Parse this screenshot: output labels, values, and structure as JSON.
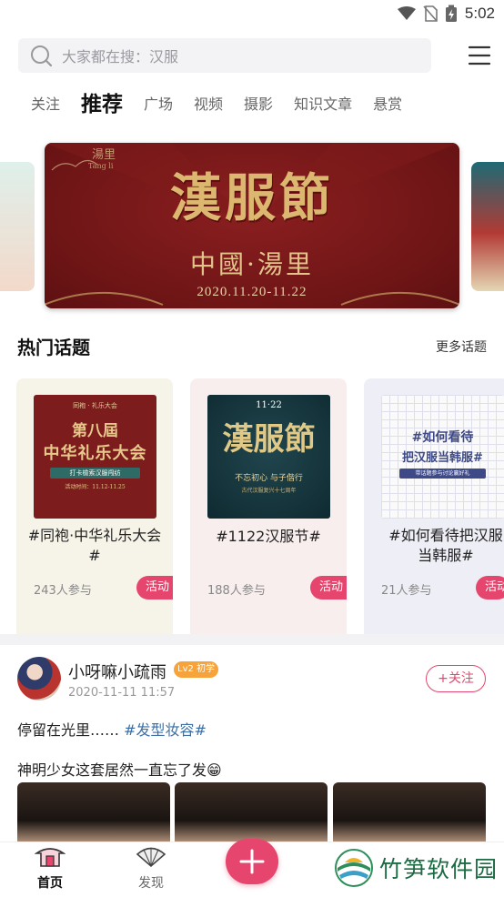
{
  "status_bar": {
    "time": "5:02"
  },
  "search": {
    "placeholder": "大家都在搜：汉服"
  },
  "tabs": [
    {
      "label": "关注",
      "active": false
    },
    {
      "label": "推荐",
      "active": true
    },
    {
      "label": "广场",
      "active": false
    },
    {
      "label": "视频",
      "active": false
    },
    {
      "label": "摄影",
      "active": false
    },
    {
      "label": "知识文章",
      "active": false
    },
    {
      "label": "悬赏",
      "active": false
    }
  ],
  "banner": {
    "logo": "湯里",
    "logo_sub": "Tang li",
    "title": "漢服節",
    "subtitle": "中國·湯里",
    "date": "2020.11.20-11.22"
  },
  "hot_topics": {
    "title": "热门话题",
    "more_label": "更多话题",
    "items": [
      {
        "name": "#同袍·中华礼乐大会#",
        "count": "243人参与",
        "badge": "活动",
        "bg": "#f6f3e8",
        "thumb": {
          "top": "同袍 · 礼乐大会",
          "title1": "第八屆",
          "title2": "中华礼乐大会",
          "ribbon": "打卡檢索汉服闯纺",
          "date": "活动时间：11.12-11.25"
        }
      },
      {
        "name": "#1122汉服节#",
        "count": "188人参与",
        "badge": "活动",
        "bg": "#f9eeee",
        "thumb": {
          "top": "11·22",
          "title": "漢服節",
          "line1": "不忘初心 与子偕行",
          "line2": "古代汉服复兴十七周年"
        }
      },
      {
        "name": "#如何看待把汉服当韩服#",
        "count": "21人参与",
        "badge": "活动",
        "bg": "#eeeef6",
        "thumb": {
          "line1": "#如何看待",
          "line2": "把汉服当韩服#",
          "ribbon": "带话题参与讨论赢好礼"
        }
      }
    ]
  },
  "post": {
    "username": "小呀嘛小疏雨",
    "level": "Lv2 初学",
    "time": "2020-11-11 11:57",
    "follow_label": "+关注",
    "text1": "停留在光里……",
    "tag": "#发型妆容#",
    "text2": "神明少女这套居然一直忘了发😁"
  },
  "bottom_nav": {
    "home": "首页",
    "discover": "发现"
  },
  "watermark": "竹笋软件园",
  "colors": {
    "accent": "#e6456d",
    "link": "#3b6fa8",
    "banner_red": "#7a1718",
    "gold": "#dcb76f"
  }
}
